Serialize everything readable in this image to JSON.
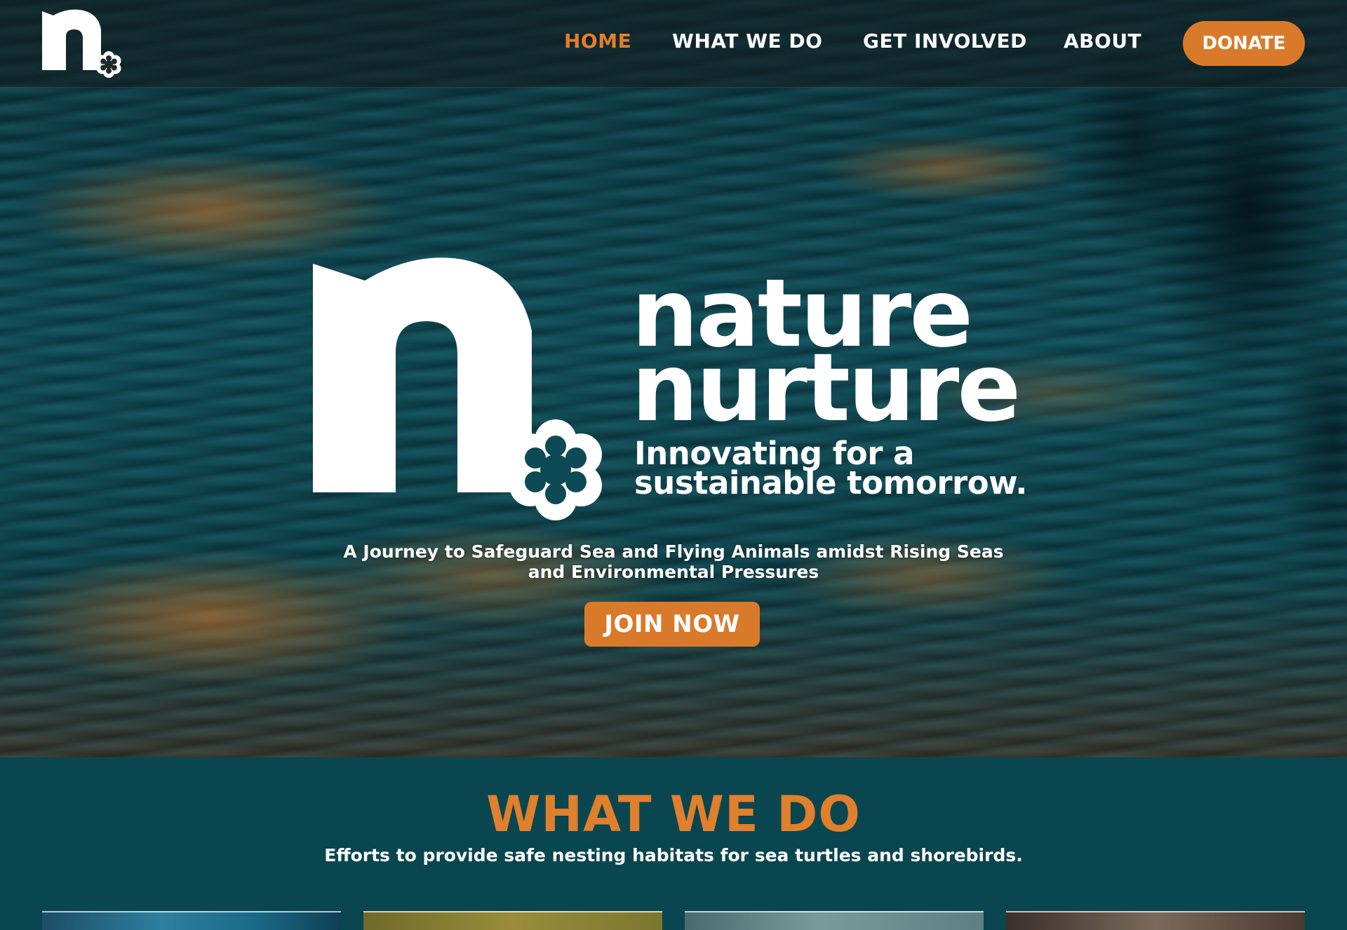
{
  "nav": {
    "links": [
      {
        "label": "HOME",
        "active": true
      },
      {
        "label": "WHAT WE DO",
        "active": false
      },
      {
        "label": "GET INVOLVED",
        "active": false
      },
      {
        "label": "ABOUT",
        "active": false
      }
    ],
    "donate_label": "DONATE"
  },
  "hero": {
    "wordmark_line1": "nature",
    "wordmark_line2": "nurture",
    "tagline_line1": "Innovating for a",
    "tagline_line2": "sustainable tomorrow.",
    "subtitle": "A Journey to Safeguard Sea and Flying Animals amidst Rising Seas and Environmental Pressures",
    "cta_label": "JOIN NOW"
  },
  "what_we_do": {
    "title": "WHAT WE DO",
    "subtitle": "Efforts to provide safe nesting habitats for sea turtles and shorebirds."
  },
  "colors": {
    "accent": "#d97a2a",
    "section_bg": "#0a4650",
    "text": "#ffffff"
  },
  "icons": {
    "logo": "n-with-flower-logo",
    "flower": "flower-icon"
  }
}
